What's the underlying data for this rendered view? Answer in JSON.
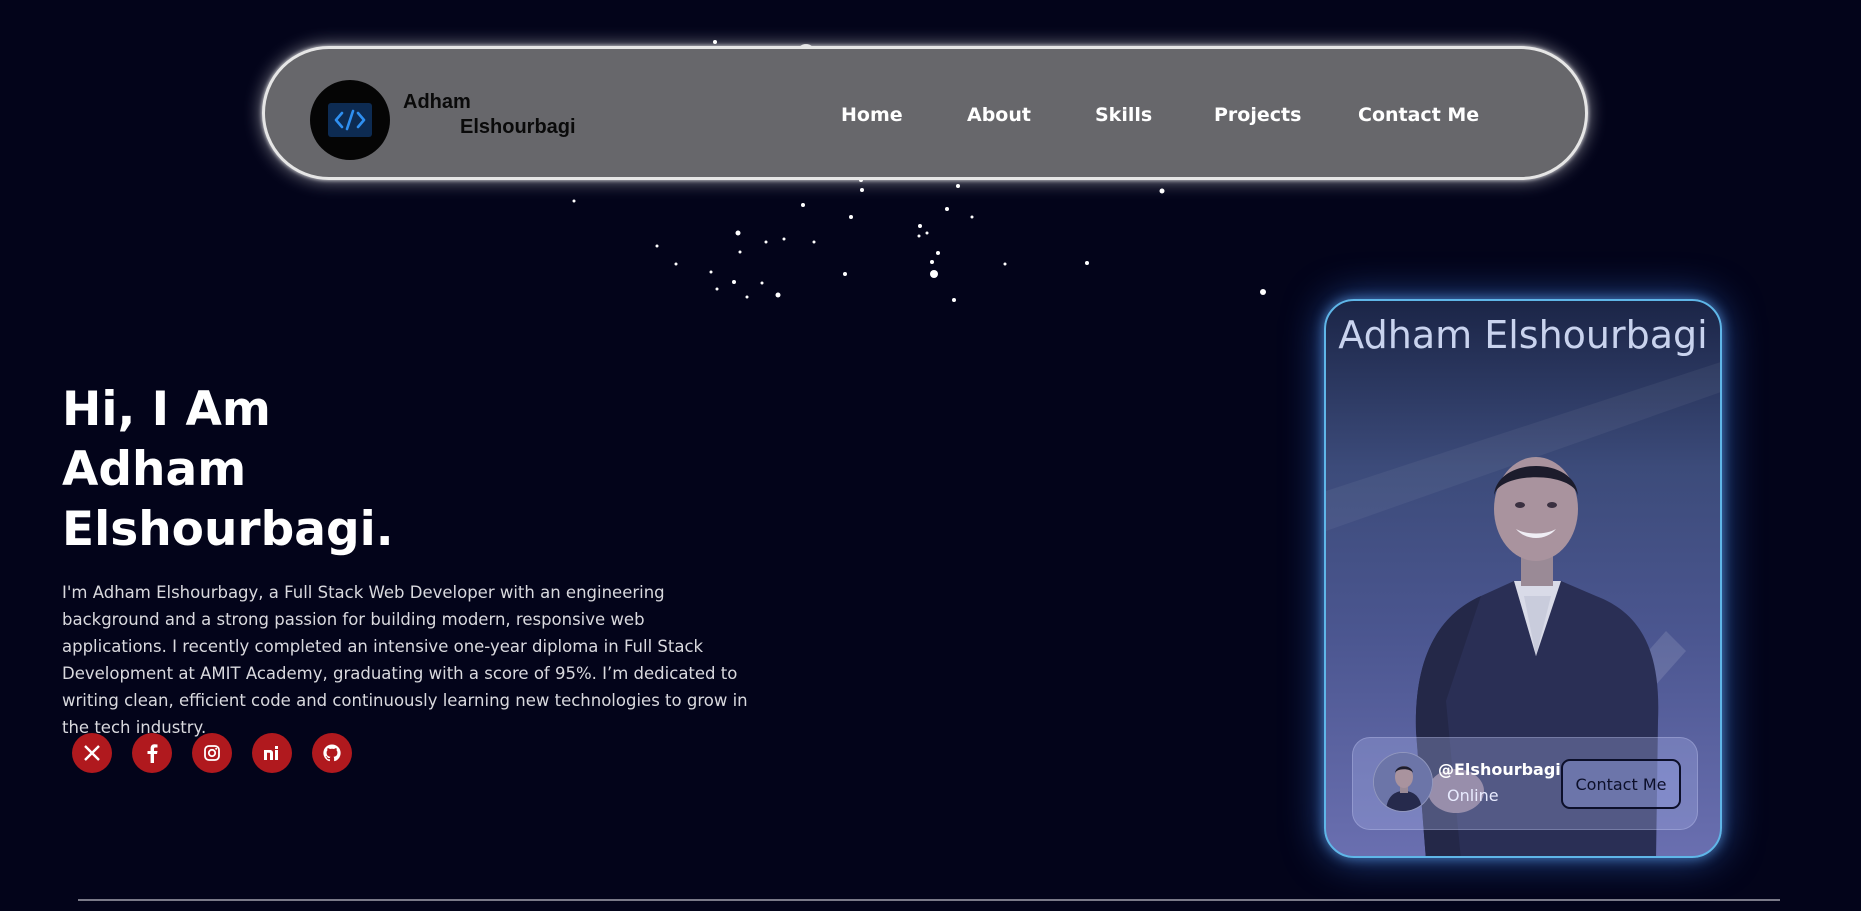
{
  "nav": {
    "brand_line1": "Adham",
    "brand_line2": "Elshourbagi",
    "logo_icon": "code-brackets-icon",
    "links": [
      {
        "label": "Home"
      },
      {
        "label": "About"
      },
      {
        "label": "Skills"
      },
      {
        "label": "Projects"
      },
      {
        "label": "Contact Me"
      }
    ]
  },
  "hero": {
    "line1": "Hi, I Am",
    "line2": "Adham",
    "line3": "Elshourbagi.",
    "description": "I'm Adham Elshourbagy, a Full Stack Web Developer with an engineering background and a strong passion for building modern, responsive web applications. I recently completed an intensive one-year diploma in Full Stack Development at AMIT Academy, graduating with a score of 95%. I’m dedicated to writing clean, efficient code and continuously learning new technologies to grow in the tech industry.",
    "socials": [
      {
        "icon": "x-twitter-icon",
        "glyph": "𝕏"
      },
      {
        "icon": "facebook-icon",
        "glyph": "f"
      },
      {
        "icon": "instagram-icon",
        "glyph": ""
      },
      {
        "icon": "ni-icon",
        "glyph": "ni"
      },
      {
        "icon": "github-icon",
        "glyph": ""
      }
    ]
  },
  "card": {
    "title": "Adham Elshourbagi",
    "handle": "@Elshourbagi",
    "status": "Online",
    "contact_label": "Contact Me"
  },
  "colors": {
    "background": "#03041a",
    "navbar": "#67676b",
    "social": "#b0191e",
    "card_border": "#5fb6e8"
  }
}
